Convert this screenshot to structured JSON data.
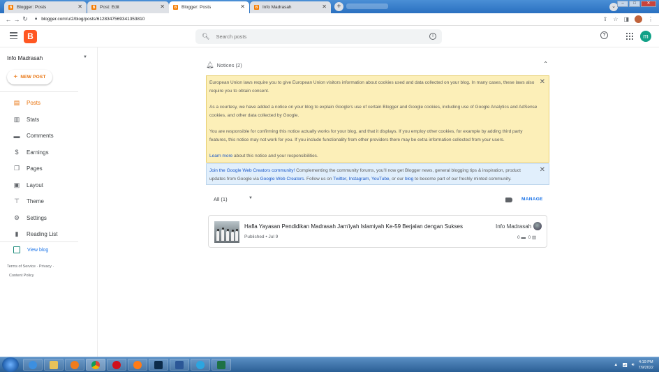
{
  "browser": {
    "tabs": [
      {
        "title": "Blogger: Posts",
        "active": false
      },
      {
        "title": "Post: Edit",
        "active": false
      },
      {
        "title": "Blogger: Posts",
        "active": true
      },
      {
        "title": "Info Madrasah",
        "active": false
      }
    ],
    "url": "blogger.com/u/2/blog/posts/6128347569341353810"
  },
  "header": {
    "logo_letter": "B",
    "search_placeholder": "Search posts",
    "user_initial": "m"
  },
  "sidebar": {
    "blog_name": "Info Madrasah",
    "new_post_label": "NEW POST",
    "items": [
      {
        "label": "Posts",
        "icon": "posts-icon",
        "active": true
      },
      {
        "label": "Stats",
        "icon": "stats-icon",
        "active": false
      },
      {
        "label": "Comments",
        "icon": "comments-icon",
        "active": false
      },
      {
        "label": "Earnings",
        "icon": "dollar-icon",
        "active": false
      },
      {
        "label": "Pages",
        "icon": "pages-icon",
        "active": false
      },
      {
        "label": "Layout",
        "icon": "layout-icon",
        "active": false
      },
      {
        "label": "Theme",
        "icon": "paint-roller-icon",
        "active": false
      },
      {
        "label": "Settings",
        "icon": "gear-icon",
        "active": false
      },
      {
        "label": "Reading List",
        "icon": "bookmark-icon",
        "active": false
      }
    ],
    "view_blog_label": "View blog",
    "footer": {
      "terms": "Terms of Service",
      "privacy": "Privacy",
      "content_policy": "Content Policy"
    }
  },
  "notices": {
    "header": "Notices (2)",
    "eu": {
      "p1": "European Union laws require you to give European Union visitors information about cookies used and data collected on your blog. In many cases, these laws also require you to obtain consent.",
      "p2": "As a courtesy, we have added a notice on your blog to explain Google's use of certain Blogger and Google cookies, including use of Google Analytics and AdSense cookies, and other data collected by Google.",
      "p3": "You are responsible for confirming this notice actually works for your blog, and that it displays. If you employ other cookies, for example by adding third party features, this notice may not work for you. If you include functionality from other providers there may be extra information collected from your users.",
      "learn_more": "Learn more",
      "p4_rest": " about this notice and your responsibilities."
    },
    "community": {
      "link1": "Join the Google Web Creators community!",
      "text1": " Complementing the community forums, you'll now get Blogger news, general blogging tips & inspiration, product updates from Google via ",
      "link2": "Google Web Creators",
      "text2": ". Follow us on ",
      "twitter": "Twitter",
      "comma1": ", ",
      "instagram": "Instagram",
      "comma2": ", ",
      "youtube": "YouTube",
      "text3": ", or our ",
      "blog": "blog",
      "text4": " to become part of our freshly minted community."
    }
  },
  "posts": {
    "filter_label": "All (1)",
    "manage_label": "MANAGE",
    "items": [
      {
        "title": "Hafla Yayasan Pendidikan Madrasah Jam'iyah Islamiyah Ke-59 Berjalan dengan Sukses",
        "status": "Published",
        "date": "Jul 9",
        "author": "Info Madrasah",
        "comments": "0",
        "views": "0"
      }
    ]
  },
  "taskbar": {
    "time": "4:19 PM",
    "date": "7/9/2022"
  },
  "colors": {
    "accent": "#e8710a",
    "blogger_orange": "#ff5722",
    "notice_yellow": "#fcefb8",
    "notice_blue": "#e1effc",
    "link_blue": "#1a57c7"
  }
}
